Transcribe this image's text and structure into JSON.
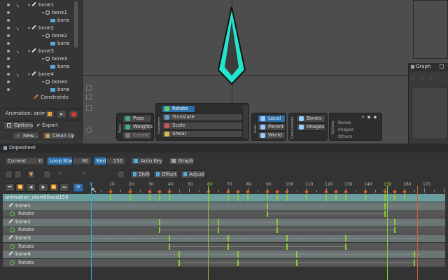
{
  "tree": {
    "items": [
      {
        "label": "bone1",
        "kind": "bone"
      },
      {
        "label": "bone1",
        "kind": "slot"
      },
      {
        "label": "bone",
        "kind": "attachment"
      },
      {
        "label": "bone2",
        "kind": "bone"
      },
      {
        "label": "bone2",
        "kind": "slot"
      },
      {
        "label": "bone",
        "kind": "attachment"
      },
      {
        "label": "bone3",
        "kind": "bone"
      },
      {
        "label": "bone3",
        "kind": "slot"
      },
      {
        "label": "bone",
        "kind": "attachment"
      },
      {
        "label": "bone4",
        "kind": "bone"
      },
      {
        "label": "bone4",
        "kind": "slot"
      },
      {
        "label": "bone",
        "kind": "attachment"
      },
      {
        "label": "Constraints",
        "kind": "constraints"
      }
    ],
    "animation_label": "Animation: anim...",
    "options_label": "Options",
    "export_label": "Export",
    "new_label": "New...",
    "cleanup_label": "Clean Up"
  },
  "toolbar": {
    "tools_group": "Tools",
    "tools": [
      "Pose",
      "Weights",
      "Create"
    ],
    "transform_group": "Transform",
    "transform": [
      "Rotate",
      "Translate",
      "Scale",
      "Shear"
    ],
    "axes_group": "Axes",
    "axes": [
      "Local",
      "Parent",
      "World"
    ],
    "compensate_group": "Compensate",
    "compensate": [
      "Bones",
      "Images"
    ],
    "options_group": "Options",
    "options": [
      "Bones",
      "Images",
      "Others"
    ]
  },
  "graph": {
    "title": "Graph"
  },
  "dopesheet": {
    "title": "Dopesheet",
    "current_label": "Current",
    "current_value": "0",
    "loop_start_label": "Loop Start",
    "loop_start_value": "60",
    "end_label": "End",
    "end_value": "150",
    "autokey_label": "Auto Key",
    "graph_label": "Graph",
    "shift_label": "Shift",
    "offset_label": "Offset",
    "adjust_label": "Adjust",
    "ruler": [
      "0",
      "10",
      "20",
      "30",
      "40",
      "50",
      "60",
      "70",
      "80",
      "90",
      "100",
      "110",
      "120",
      "130",
      "140",
      "150",
      "160",
      "170"
    ],
    "rows": [
      {
        "label": "animation_start60end150",
        "type": "anim",
        "keys": [
          10,
          20,
          30,
          35,
          40,
          60,
          70,
          75,
          80,
          90,
          95,
          100,
          110,
          120,
          125,
          130,
          140,
          150,
          155,
          160
        ]
      },
      {
        "label": "bone1",
        "type": "bone",
        "keys": [
          90,
          150
        ]
      },
      {
        "label": "Rotate",
        "type": "rot",
        "keys": [
          90,
          150
        ]
      },
      {
        "label": "bone2",
        "type": "bone",
        "keys": [
          35,
          65,
          95,
          155
        ]
      },
      {
        "label": "Rotate",
        "type": "rot",
        "keys": [
          35,
          65,
          95,
          155
        ]
      },
      {
        "label": "bone3",
        "type": "bone",
        "keys": [
          40,
          70,
          100,
          130
        ]
      },
      {
        "label": "Rotate",
        "type": "rot",
        "keys": [
          40,
          70,
          100,
          130
        ]
      },
      {
        "label": "bone4",
        "type": "bone",
        "keys": [
          45,
          75,
          105,
          165
        ]
      },
      {
        "label": "Rotate",
        "type": "rot",
        "keys": [
          45,
          75,
          105,
          165
        ]
      }
    ]
  },
  "colors": {
    "accent": "#2e6fa8",
    "key": "#88cc33",
    "cyan": "#22e0c8"
  }
}
